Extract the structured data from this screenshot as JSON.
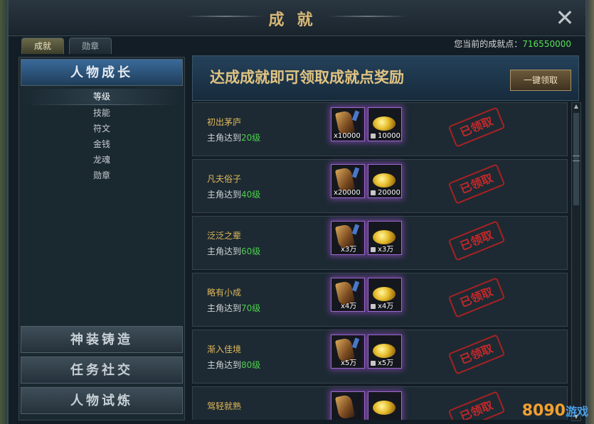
{
  "window": {
    "title": "成就",
    "close_glyph": "✕"
  },
  "tabs": [
    {
      "label": "成就",
      "active": true
    },
    {
      "label": "勋章",
      "active": false
    }
  ],
  "points": {
    "label": "您当前的成就点：",
    "value": "716550000"
  },
  "sidebar": {
    "categories": [
      {
        "label": "人物成长",
        "open": true
      },
      {
        "label": "神装铸造",
        "open": false
      },
      {
        "label": "任务社交",
        "open": false
      },
      {
        "label": "人物试炼",
        "open": false
      }
    ],
    "items": [
      {
        "label": "等级",
        "selected": true
      },
      {
        "label": "技能",
        "selected": false
      },
      {
        "label": "符文",
        "selected": false
      },
      {
        "label": "金钱",
        "selected": false
      },
      {
        "label": "龙魂",
        "selected": false
      },
      {
        "label": "勋章",
        "selected": false
      }
    ]
  },
  "banner": {
    "text": "达成成就即可领取成就点奖励",
    "claim_all": "一键领取"
  },
  "achievements": [
    {
      "name": "初出茅庐",
      "desc_prefix": "主角达到",
      "level": "20级",
      "reward_a": "x10000",
      "reward_b": "10000",
      "status": "已领取"
    },
    {
      "name": "凡夫俗子",
      "desc_prefix": "主角达到",
      "level": "40级",
      "reward_a": "x20000",
      "reward_b": "20000",
      "status": "已领取"
    },
    {
      "name": "泛泛之辈",
      "desc_prefix": "主角达到",
      "level": "60级",
      "reward_a": "x3万",
      "reward_b": "x3万",
      "status": "已领取"
    },
    {
      "name": "略有小成",
      "desc_prefix": "主角达到",
      "level": "70级",
      "reward_a": "x4万",
      "reward_b": "x4万",
      "status": "已领取"
    },
    {
      "name": "渐入佳境",
      "desc_prefix": "主角达到",
      "level": "80级",
      "reward_a": "x5万",
      "reward_b": "x5万",
      "status": "已领取"
    },
    {
      "name": "驾轻就熟",
      "desc_prefix": "",
      "level": "",
      "reward_a": "",
      "reward_b": "",
      "status": "已领取"
    }
  ],
  "watermark": {
    "main": "8090",
    "sub": "游戏"
  },
  "colors": {
    "accent_gold": "#e2c482",
    "points_value": "#58e058",
    "level_green": "#4ad04a",
    "stamp_red": "#e02828",
    "slot_glow": "#9a6acc"
  },
  "icons": {
    "reward_a": "shield-armor-icon",
    "reward_b": "gold-coins-icon",
    "lock": "lock-icon",
    "close": "close-icon"
  }
}
